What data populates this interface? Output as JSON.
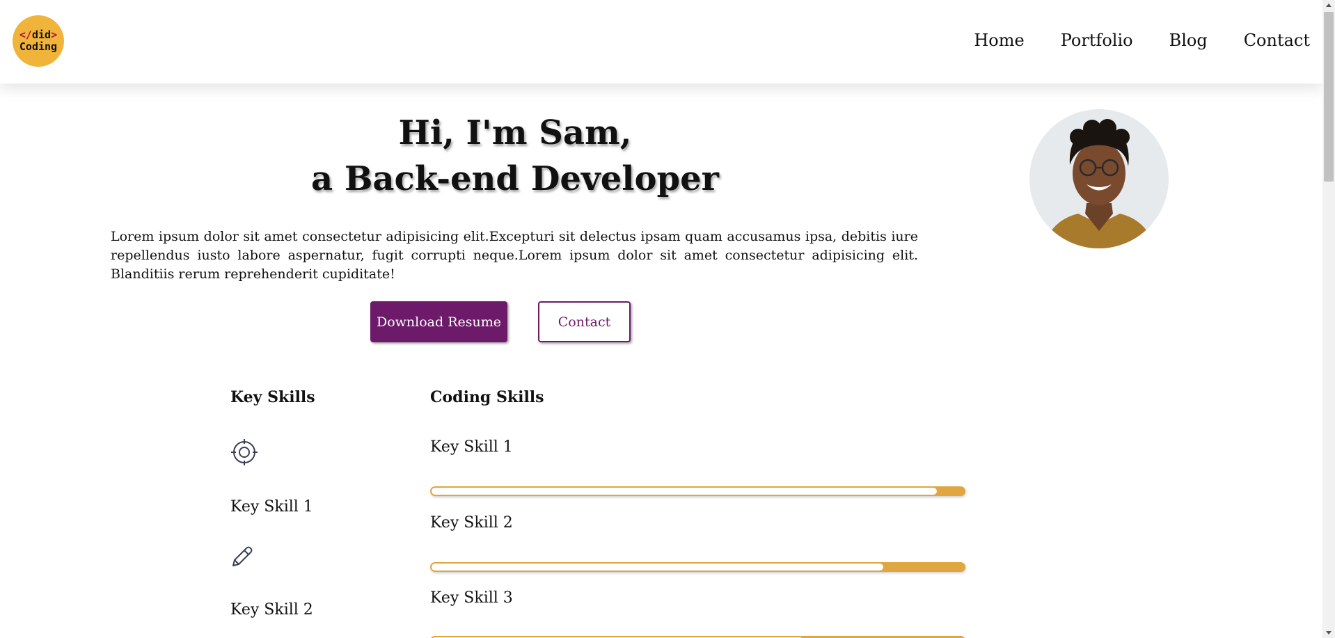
{
  "logo": {
    "open_tag": "</",
    "word1": "did",
    "close_tag": ">",
    "word2": "Coding"
  },
  "nav": {
    "items": [
      "Home",
      "Portfolio",
      "Blog",
      "Contact"
    ]
  },
  "hero": {
    "title_line1": "Hi, I'm Sam,",
    "title_line2": "a Back-end Developer",
    "intro": "Lorem ipsum dolor sit amet consectetur adipisicing elit.Excepturi sit delectus ipsam quam accusamus ipsa, debitis iure repellendus iusto labore aspernatur, fugit corrupti neque.Lorem ipsum dolor sit amet consectetur adipisicing elit. Blanditiis rerum reprehenderit cupiditate!",
    "download_label": "Download Resume",
    "contact_label": "Contact"
  },
  "key_skills": {
    "heading": "Key Skills",
    "items": [
      {
        "label": "Key Skill 1",
        "icon": "target-icon"
      },
      {
        "label": "Key Skill 2",
        "icon": "pencil-icon"
      }
    ]
  },
  "coding_skills": {
    "heading": "Coding Skills",
    "items": [
      {
        "label": "Key Skill 1",
        "level": 0.95
      },
      {
        "label": "Key Skill 2",
        "level": 0.85
      },
      {
        "label": "Key Skill 3",
        "level": 0.7
      }
    ]
  },
  "colors": {
    "accent": "#6d1a6a",
    "gold": "#e0a640",
    "logo_bg": "#f0b43a"
  }
}
